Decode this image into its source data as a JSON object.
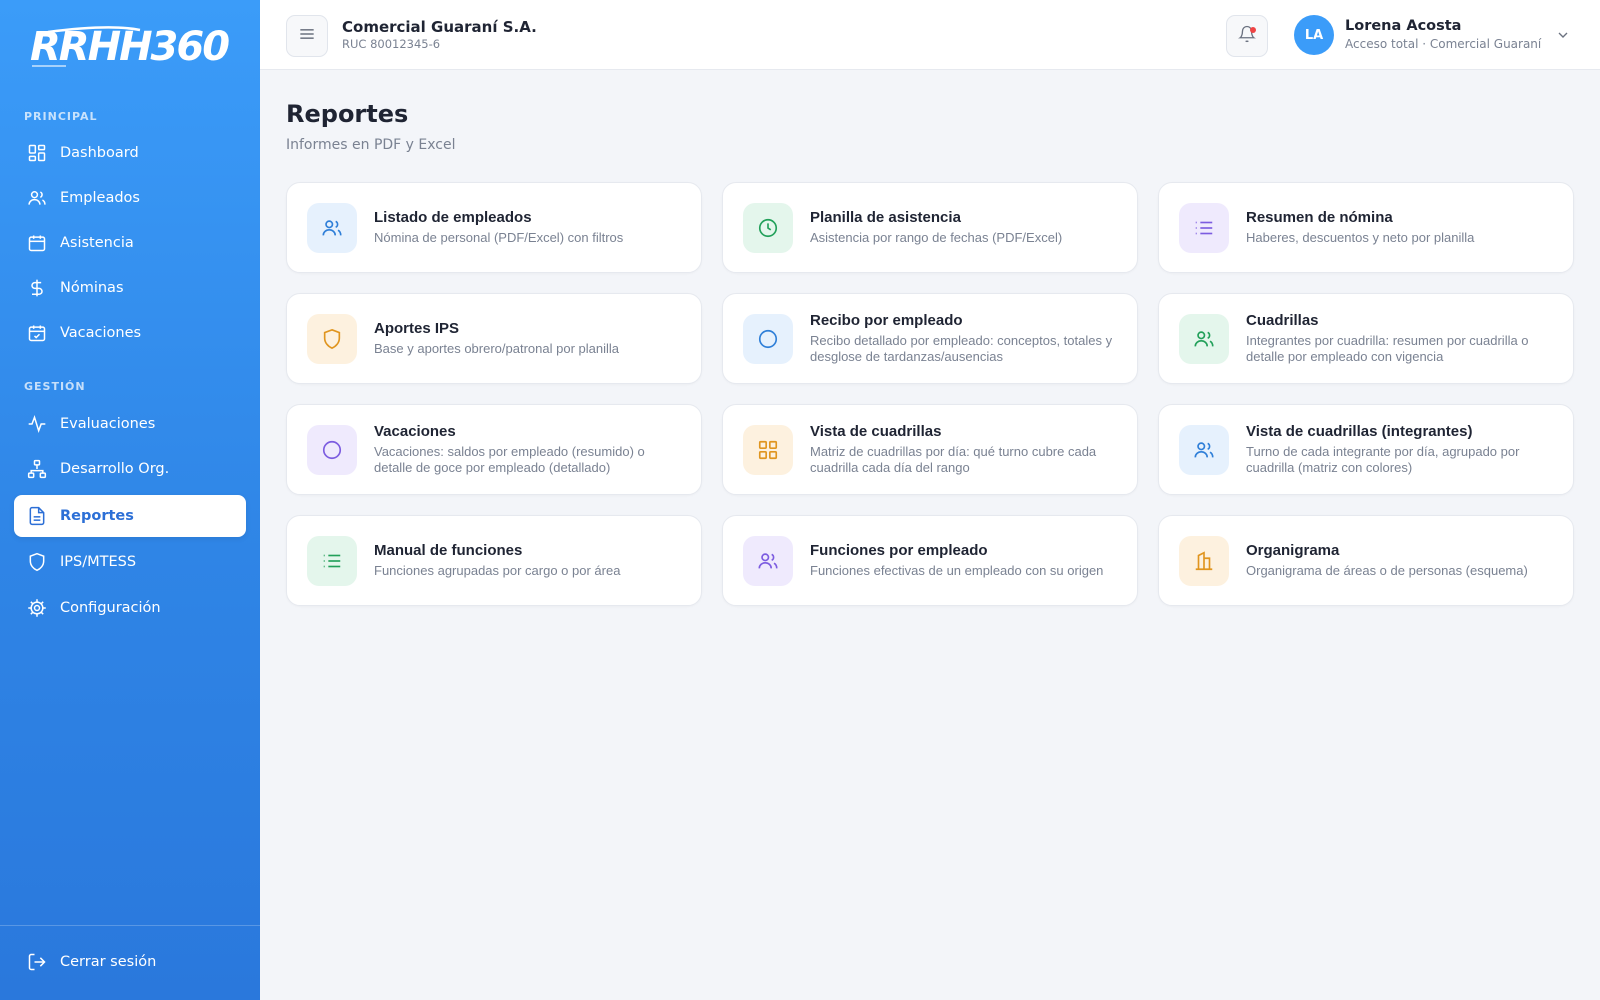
{
  "app": {
    "logo_text": "RRHH360°"
  },
  "sidebar": {
    "sections": [
      {
        "label": "PRINCIPAL"
      },
      {
        "label": "GESTIÓN"
      }
    ],
    "items": [
      {
        "label": "Dashboard",
        "icon": "grid-icon"
      },
      {
        "label": "Empleados",
        "icon": "users-icon"
      },
      {
        "label": "Asistencia",
        "icon": "calendar-icon"
      },
      {
        "label": "Nóminas",
        "icon": "dollar-icon"
      },
      {
        "label": "Vacaciones",
        "icon": "calendar-check-icon"
      },
      {
        "label": "Evaluaciones",
        "icon": "activity-icon"
      },
      {
        "label": "Desarrollo Org.",
        "icon": "org-tree-icon"
      },
      {
        "label": "Reportes",
        "icon": "file-text-icon",
        "active": true
      },
      {
        "label": "IPS/MTESS",
        "icon": "shield-icon"
      },
      {
        "label": "Configuración",
        "icon": "gear-icon"
      }
    ],
    "logout_label": "Cerrar sesión"
  },
  "header": {
    "company_name": "Comercial Guaraní S.A.",
    "company_ruc": "RUC 80012345-6",
    "user": {
      "initials": "LA",
      "name": "Lorena Acosta",
      "role": "Acceso total · Comercial Guaraní"
    }
  },
  "page": {
    "title": "Reportes",
    "subtitle": "Informes en PDF y Excel"
  },
  "reports": [
    {
      "title": "Listado de empleados",
      "desc": "Nómina de personal (PDF/Excel) con filtros",
      "icon": "users-icon",
      "color": "#2f7fd8"
    },
    {
      "title": "Planilla de asistencia",
      "desc": "Asistencia por rango de fechas (PDF/Excel)",
      "icon": "clock-icon",
      "color": "#22a05a"
    },
    {
      "title": "Resumen de nómina",
      "desc": "Haberes, descuentos y neto por planilla",
      "icon": "list-icon",
      "color": "#7c5ce0"
    },
    {
      "title": "Aportes IPS",
      "desc": "Base y aportes obrero/patronal por planilla",
      "icon": "shield-icon",
      "color": "#e0951f"
    },
    {
      "title": "Recibo por empleado",
      "desc": "Recibo detallado por empleado: conceptos, totales y desglose de tardanzas/ausencias",
      "icon": "circle-icon",
      "color": "#2f7fd8"
    },
    {
      "title": "Cuadrillas",
      "desc": "Integrantes por cuadrilla: resumen por cuadrilla o detalle por empleado con vigencia",
      "icon": "users-icon",
      "color": "#22a05a"
    },
    {
      "title": "Vacaciones",
      "desc": "Vacaciones: saldos por empleado (resumido) o detalle de goce por empleado (detallado)",
      "icon": "circle-icon",
      "color": "#7c5ce0"
    },
    {
      "title": "Vista de cuadrillas",
      "desc": "Matriz de cuadrillas por día: qué turno cubre cada cuadrilla cada día del rango",
      "icon": "grid-icon",
      "color": "#e0951f"
    },
    {
      "title": "Vista de cuadrillas (integrantes)",
      "desc": "Turno de cada integrante por día, agrupado por cuadrilla (matriz con colores)",
      "icon": "users-icon",
      "color": "#2f7fd8"
    },
    {
      "title": "Manual de funciones",
      "desc": "Funciones agrupadas por cargo o por área",
      "icon": "list-icon",
      "color": "#22a05a"
    },
    {
      "title": "Funciones por empleado",
      "desc": "Funciones efectivas de un empleado con su origen",
      "icon": "users-icon",
      "color": "#7c5ce0"
    },
    {
      "title": "Organigrama",
      "desc": "Organigrama de áreas o de personas (esquema)",
      "icon": "building-icon",
      "color": "#e0951f"
    }
  ]
}
